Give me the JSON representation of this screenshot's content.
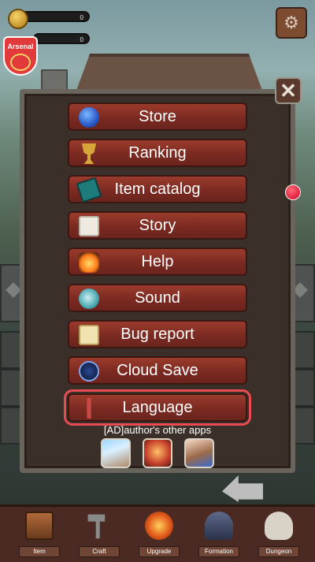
{
  "hud": {
    "coins_value": "0",
    "gems_value": "0",
    "club_badge_text": "Arsenal"
  },
  "settings": {
    "icon": "gear-icon"
  },
  "dialog": {
    "close_label": "✕",
    "menu": [
      {
        "label": "Store",
        "icon": "orb-icon"
      },
      {
        "label": "Ranking",
        "icon": "trophy-icon"
      },
      {
        "label": "Item catalog",
        "icon": "book-icon",
        "has_notification": true
      },
      {
        "label": "Story",
        "icon": "scroll-icon"
      },
      {
        "label": "Help",
        "icon": "lantern-icon"
      },
      {
        "label": "Sound",
        "icon": "shell-icon"
      },
      {
        "label": "Bug report",
        "icon": "envelope-icon"
      },
      {
        "label": "Cloud Save",
        "icon": "cloud-rune-icon"
      },
      {
        "label": "Language",
        "icon": "quill-icon",
        "selected": true
      }
    ],
    "ad_label": "[AD]author's other apps"
  },
  "bottom_nav": [
    {
      "label": "Item",
      "icon": "chest-icon"
    },
    {
      "label": "Craft",
      "icon": "hammer-icon"
    },
    {
      "label": "Upgrade",
      "icon": "fire-orb-icon"
    },
    {
      "label": "Formation",
      "icon": "helmet-icon"
    },
    {
      "label": "Dungeon",
      "icon": "skull-icon"
    }
  ],
  "colors": {
    "button_red": "#7b2a21",
    "selected_outline": "#e84b52",
    "notification_dot": "#e0203a"
  }
}
